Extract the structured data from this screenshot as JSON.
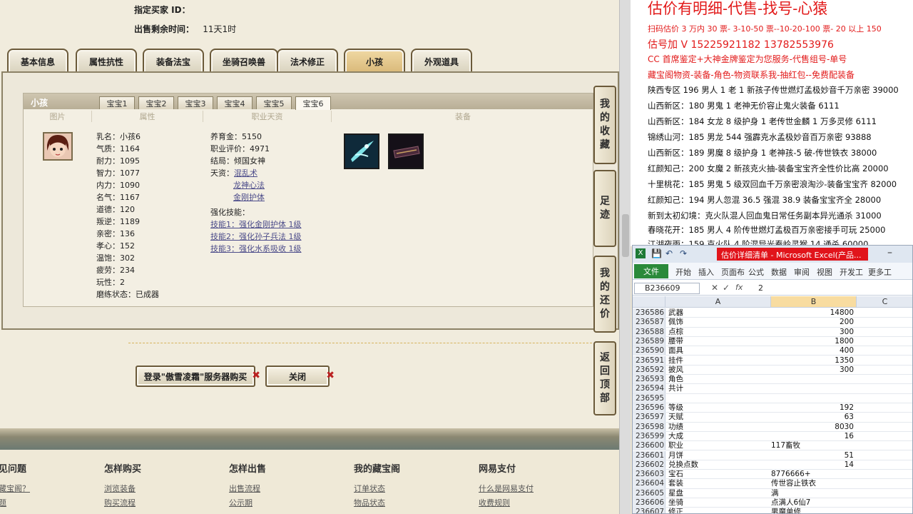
{
  "game": {
    "buyer_label": "指定买家 ID：",
    "buyer_value": "",
    "time_label": "出售剩余时间：",
    "time_value": "11天1时",
    "tabs": [
      "基本信息",
      "属性抗性",
      "装备法宝",
      "坐骑召唤兽",
      "法术修正",
      "小孩",
      "外观道具"
    ],
    "active_tab": "小孩",
    "child_panel": {
      "title": "小孩",
      "subtabs": [
        "宝宝1",
        "宝宝2",
        "宝宝3",
        "宝宝4",
        "宝宝5",
        "宝宝6"
      ],
      "active_subtab": "宝宝6",
      "col_heads": [
        "图片",
        "属性",
        "职业天资",
        "装备"
      ],
      "attrs": [
        "乳名：小孩6",
        "气质：1164",
        "耐力：1095",
        "智力：1077",
        "内力：1090",
        "名气：1167",
        "道德：120",
        "叛逆：1189",
        "亲密：136",
        "孝心：152",
        "温饱：302",
        "疲劳：234",
        "玩性：2",
        "磨练状态：已成器"
      ],
      "career": {
        "raise_money": "养育金：5150",
        "career_score": "职业评价：4971",
        "ending": "结局：倾国女神",
        "talent_label": "天资：",
        "talents": [
          "混乱术",
          "龙神心法",
          "金刚护体"
        ],
        "skill_label": "强化技能：",
        "skills": [
          "技能1：强化金刚护体 1级",
          "技能2：强化孙子兵法 1级",
          "技能3：强化水系吸收 1级"
        ]
      }
    },
    "side_nav": [
      "我的收藏",
      "足迹",
      "我的还价",
      "返回顶部"
    ],
    "login_button": "登录\"傲雪凌霜\"服务器购买",
    "close_button": "关闭",
    "footer": [
      {
        "title": "见问题",
        "links": [
          "藏宝阁？",
          "题"
        ]
      },
      {
        "title": "怎样购买",
        "links": [
          "浏览装备",
          "购买流程"
        ]
      },
      {
        "title": "怎样出售",
        "links": [
          "出售流程",
          "公示期"
        ]
      },
      {
        "title": "我的藏宝阁",
        "links": [
          "订单状态",
          "物品状态"
        ]
      },
      {
        "title": "网易支付",
        "links": [
          "什么是网易支付",
          "收费规则"
        ]
      }
    ]
  },
  "notes": {
    "title": "估价有明细-代售-找号-心猿",
    "red_lines": [
      "扫码估价 3 万内 30 票- 3-10-50 票--10-20-100 票- 20 以上 150",
      "估号加 V 15225921182   13782553976",
      "CC 首席鉴定+大神金牌鉴定为您服务-代售组号-单号",
      "藏宝阁物资-装备-角色-物资联系我-抽红包--免费配装备"
    ],
    "listings": [
      "陕西专区 196 男人 1 老 1 新孩子传世燃灯孟极妙音千万亲密 39000",
      "山西新区：180 男鬼 1 老神无价容止鬼火装备 6111",
      "山西新区：184 女龙 8 级护身 1 老传世金麟 1 万多灵修 6111",
      "锦绣山河：185 男龙 544 强霹克水孟极妙音百万亲密 93888",
      "山西新区：189 男魔 8 级护身 1 老神孩-5 破-传世铁衣 38000",
      "红颜知己：200 女魔 2 新孩克火抽-装备宝宝齐全性价比高 20000",
      "十里桃花：185 男鬼 5 级双回血千万亲密浪淘沙-装备宝宝齐 82000",
      "红颜知己：194 男人忽混 36.5 强混 38.9 装备宝宝齐全 28000",
      "新到太初幻境：克火队混人回血鬼日常任务副本异光通杀 31000",
      "春晓花开：185 男人 4 阶传世燃灯孟极百万亲密接手可玩 25000",
      "江湖夜雨：159 克火队 4 阶混异光秦岭灵猴 14 通杀 60000"
    ]
  },
  "excel": {
    "title": "估价详细清单 - Microsoft Excel(产品...",
    "menus": [
      "开始",
      "插入",
      "页面布",
      "公式",
      "数据",
      "审阅",
      "视图",
      "开发工",
      "更多工"
    ],
    "file_label": "文件",
    "name_box": "B236609",
    "formula": "2",
    "col_headers": [
      "A",
      "B",
      "C"
    ],
    "rows": [
      {
        "n": "236586",
        "a": "武器",
        "b": "14800",
        "num": true
      },
      {
        "n": "236587",
        "a": "佩饰",
        "b": "200",
        "num": true
      },
      {
        "n": "236588",
        "a": "点棕",
        "b": "300",
        "num": true
      },
      {
        "n": "236589",
        "a": "腰带",
        "b": "1800",
        "num": true
      },
      {
        "n": "236590",
        "a": "面具",
        "b": "400",
        "num": true
      },
      {
        "n": "236591",
        "a": "挂件",
        "b": "1350",
        "num": true
      },
      {
        "n": "236592",
        "a": "披风",
        "b": "300",
        "num": true
      },
      {
        "n": "236593",
        "a": "角色",
        "b": "",
        "num": true
      },
      {
        "n": "236594",
        "a": "共计",
        "b": "",
        "num": true
      },
      {
        "n": "236595",
        "a": "",
        "b": "",
        "num": true
      },
      {
        "n": "236596",
        "a": "等级",
        "b": "192",
        "num": true
      },
      {
        "n": "236597",
        "a": "天赋",
        "b": "63",
        "num": true
      },
      {
        "n": "236598",
        "a": "功绩",
        "b": "8030",
        "num": true
      },
      {
        "n": "236599",
        "a": "大成",
        "b": "16",
        "num": true
      },
      {
        "n": "236600",
        "a": "职业",
        "b": "117畜牧",
        "num": false
      },
      {
        "n": "236601",
        "a": "月饼",
        "b": "51",
        "num": true
      },
      {
        "n": "236602",
        "a": "兑换点数",
        "b": "14",
        "num": true
      },
      {
        "n": "236603",
        "a": "宝石",
        "b": "8776666+",
        "num": false
      },
      {
        "n": "236604",
        "a": "套装",
        "b": "传世容止铁衣",
        "num": false
      },
      {
        "n": "236605",
        "a": "星盘",
        "b": "满",
        "num": false
      },
      {
        "n": "236606",
        "a": "坐骑",
        "b": "点满人6仙7",
        "num": false
      },
      {
        "n": "236607",
        "a": "修正",
        "b": "男魔单修",
        "num": false
      }
    ]
  }
}
